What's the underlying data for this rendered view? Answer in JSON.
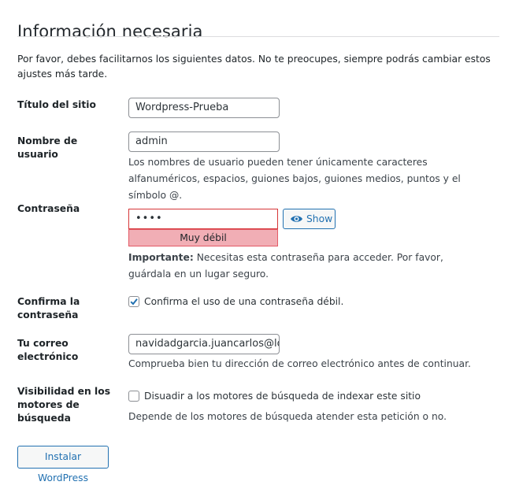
{
  "page": {
    "title": "Información necesaria",
    "intro": "Por favor, debes facilitarnos los siguientes datos. No te preocupes, siempre podrás cambiar estos ajustes más tarde."
  },
  "site_title": {
    "label": "Título del sitio",
    "value": "Wordpress-Prueba"
  },
  "username": {
    "label": "Nombre de usuario",
    "value": "admin",
    "description": "Los nombres de usuario pueden tener únicamente caracteres alfanuméricos, espacios, guiones bajos, guiones medios, puntos y el símbolo @."
  },
  "password": {
    "label": "Contraseña",
    "value": "••••",
    "show_label": "Show",
    "show_icon": "eye-icon",
    "strength": "Muy débil",
    "strength_color": "#f1aeb5",
    "important_label": "Importante:",
    "important_text": "Necesitas esta contraseña para acceder. Por favor, guárdala en un lugar seguro."
  },
  "confirm_password": {
    "label": "Confirma la contraseña",
    "checkbox_label": "Confirma el uso de una contraseña débil.",
    "checked": true
  },
  "email": {
    "label": "Tu correo electrónico",
    "value": "navidadgarcia.juancarlos@losce",
    "description": "Comprueba bien tu dirección de correo electrónico antes de continuar."
  },
  "search_visibility": {
    "label": "Visibilidad en los motores de búsqueda",
    "checkbox_label": "Disuadir a los motores de búsqueda de indexar este sitio",
    "checked": false,
    "description": "Depende de los motores de búsqueda atender esta petición o no."
  },
  "install_button": {
    "label": "Instalar WordPress"
  },
  "colors": {
    "accent": "#2271b1",
    "error_border": "#d63638"
  }
}
